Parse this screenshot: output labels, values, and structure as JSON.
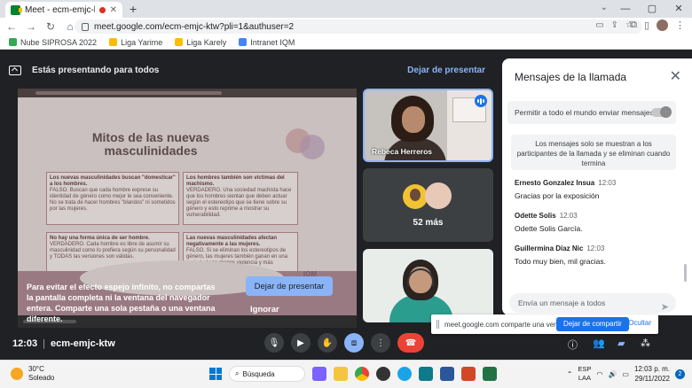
{
  "browser": {
    "tab_title": "Meet - ecm-emjc-ktw",
    "new_tab": "+",
    "url": "meet.google.com/ecm-emjc-ktw?pli=1&authuser=2",
    "bookmarks": [
      {
        "label": "Nube SIPROSA 2022",
        "color": "#34a853"
      },
      {
        "label": "Liga Yarime",
        "color": "#fbbc04"
      },
      {
        "label": "Liga Karely",
        "color": "#fbbc04"
      },
      {
        "label": "Intranet IQM",
        "color": "#4285f4"
      }
    ]
  },
  "meet": {
    "presenting_banner": "Estás presentando para todos",
    "stop_presenting_link": "Dejar de presentar",
    "meeting_time": "12:03",
    "meeting_code": "ecm-emjc-ktw",
    "mirror_warning": "Para evitar el efecto espejo infinito, no compartas la pantalla completa ni la ventana del navegador entera. Comparte una sola pestaña o una ventana diferente.",
    "stop_presenting_button": "Dejar de presentar",
    "ignore_button": "Ignorar",
    "accent_color": "#8ab4f8",
    "end_call_color": "#ea4335"
  },
  "slide": {
    "title": "Mitos de las nuevas masculinidades",
    "brand": "IQM",
    "boxes": [
      {
        "title": "Los nuevas masculinidades buscan \"domesticar\" a los hombres.",
        "body": "FALSO. Buscan que cada hombre exprese su identidad de género como mejor le sea conveniente. No se trata de hacer hombres \"blandos\" ni sometidos por las mujeres."
      },
      {
        "title": "Los hombres también son víctimas del machismo.",
        "body": "VERDADERO. Una sociedad machista hace que los hombres sientan que deben actuar según el estereotipo que se tiene sobre su género y esto reprime a mostrar su vulnerabilidad."
      },
      {
        "title": "No hay una forma única de ser hombre.",
        "body": "VERDADERO. Cada hombre es libre de asumir su masculinidad como lo prefiera según su personalidad y TODAS las versiones son válidas."
      },
      {
        "title": "Las nuevas masculinidades afectan negativamente a las mujeres.",
        "body": "FALSO. Si se eliminan los estereotipos de género, las mujeres también ganan en una sociedad con menos violencia y más igualdad."
      }
    ]
  },
  "tiles": [
    {
      "name": "Rebeca Herreros",
      "speaking": true
    },
    {
      "name": "52 más"
    },
    {
      "name": ""
    }
  ],
  "chat": {
    "title": "Mensajes de la llamada",
    "allow_label": "Permitir a todo el mundo enviar mensajes",
    "notice": "Los mensajes solo se muestran a los participantes de la llamada y se eliminan cuando termina",
    "messages": [
      {
        "author": "Ernesto Gonzalez Insua",
        "time": "12:03",
        "text": "Gracias por la exposición"
      },
      {
        "author": "Odette Solis",
        "time": "12:03",
        "text": "Odette Solis García."
      },
      {
        "author": "Guillermina Díaz Nic",
        "time": "12:03",
        "text": "Todo muy bien, mil gracias."
      }
    ],
    "input_placeholder": "Envía un mensaje a todos"
  },
  "share_popup": {
    "text": "meet.google.com comparte una ventana.",
    "stop_button": "Dejar de compartir",
    "hide_link": "Ocultar"
  },
  "taskbar": {
    "temperature": "30°C",
    "weather": "Soleado",
    "search": "Búsqueda",
    "lang1": "ESP",
    "lang2": "LAA",
    "time": "12:03 p. m.",
    "date": "29/11/2022",
    "notifications": "2"
  }
}
